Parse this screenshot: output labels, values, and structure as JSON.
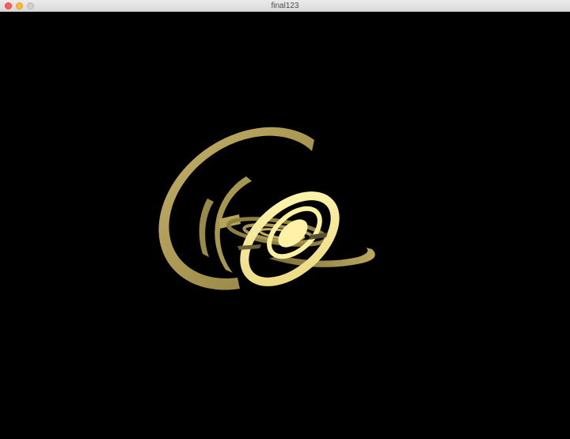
{
  "window": {
    "title": "final123"
  },
  "scene": {
    "background": "#000000",
    "primary_color": "#b9a65a",
    "highlight_color": "#fff4a8",
    "shadow_color": "#6e6234"
  }
}
